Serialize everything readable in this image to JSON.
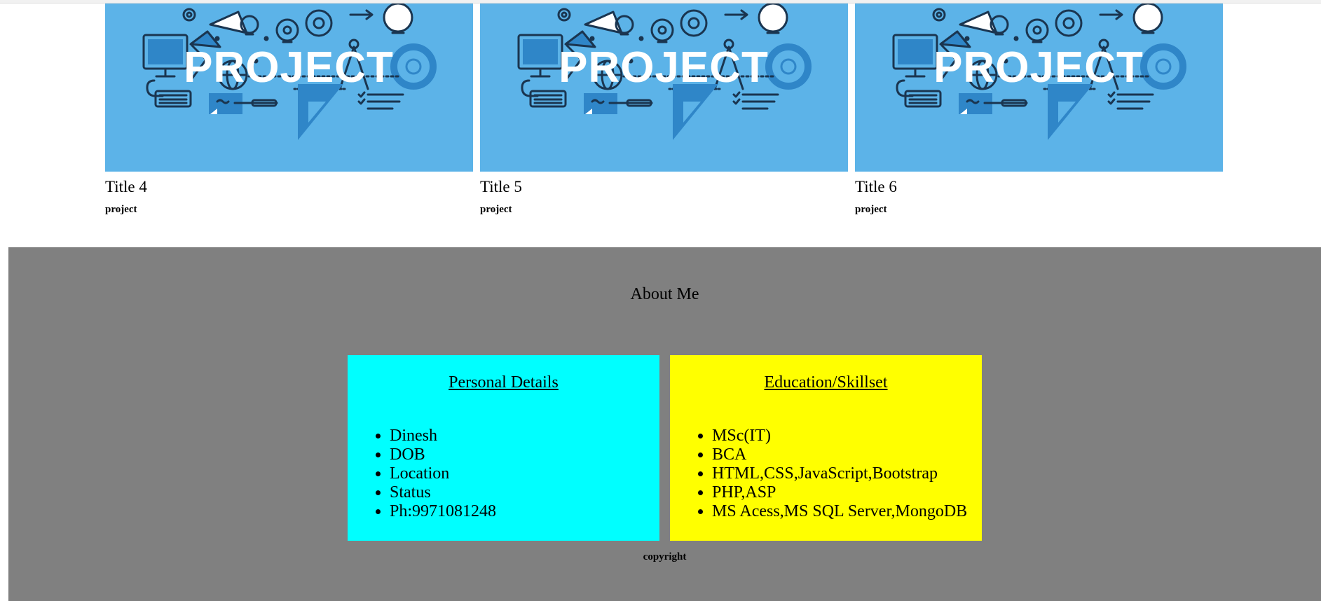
{
  "projects": [
    {
      "image_text": "PROJECT",
      "title": "Title 4",
      "tag": "project"
    },
    {
      "image_text": "PROJECT",
      "title": "Title 5",
      "tag": "project"
    },
    {
      "image_text": "PROJECT",
      "title": "Title 6",
      "tag": "project"
    }
  ],
  "about": {
    "title": "About Me",
    "personal": {
      "heading": "Personal Details",
      "items": [
        "Dinesh",
        "DOB",
        "Location",
        "Status",
        "Ph:9971081248"
      ]
    },
    "education": {
      "heading": "Education/Skillset",
      "items": [
        "MSc(IT)",
        "BCA",
        "HTML,CSS,JavaScript,Bootstrap",
        "PHP,ASP",
        "MS Acess,MS SQL Server,MongoDB"
      ]
    },
    "copyright": "copyright"
  },
  "colors": {
    "thumb_bg": "#5cb3e8",
    "about_bg": "#808080",
    "personal_bg": "#00ffff",
    "education_bg": "#ffff00"
  }
}
